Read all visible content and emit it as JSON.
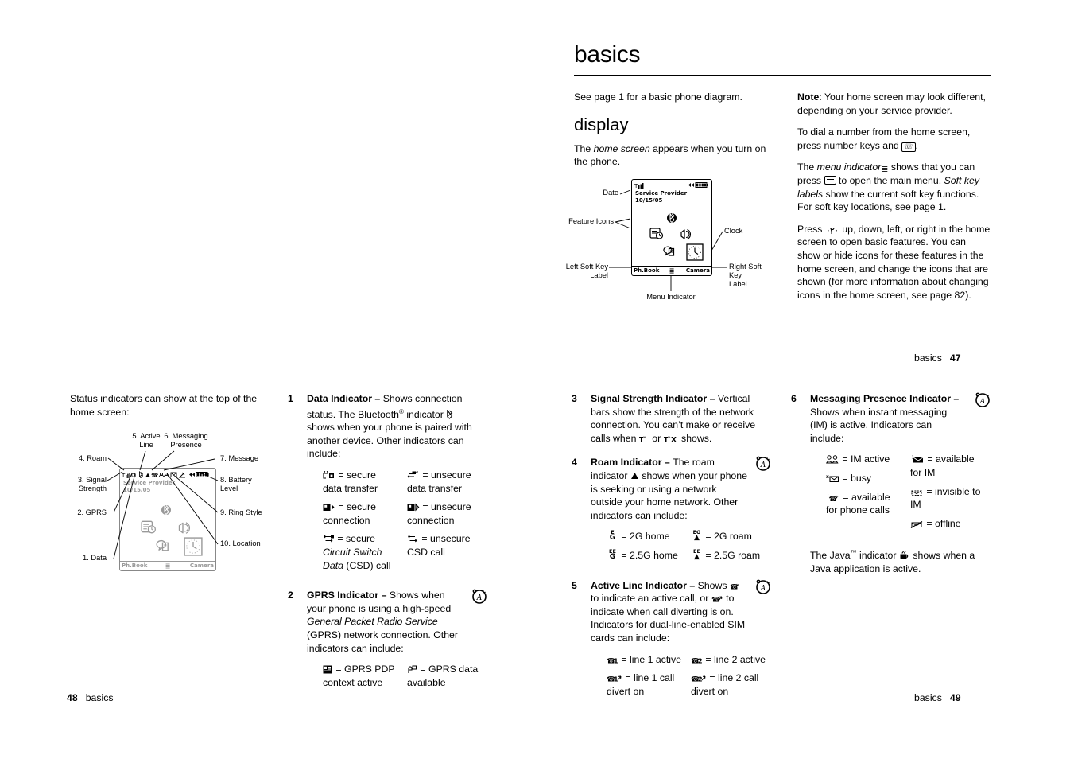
{
  "page47": {
    "title": "basics",
    "intro": "See page 1 for a basic phone diagram.",
    "section_heading": "display",
    "home_screen_p_a": "The ",
    "home_screen_p_it": "home screen",
    "home_screen_p_b": " appears when you turn on the phone.",
    "note_label": "Note",
    "note_text": ": Your home screen may look different, depending on your service provider.",
    "dial_text_a": "To dial a number from the home screen, press number keys and ",
    "dial_text_b": ".",
    "menu_a": "The ",
    "menu_it": "menu indicator",
    "menu_b": " shows that you can press ",
    "menu_c": " to open the main menu. ",
    "menu_it2": "Soft key labels",
    "menu_d": " show the current soft key functions. For soft key locations, see page 1.",
    "press_a": "Press ",
    "press_b": " up, down, left, or right in the home screen to open basic features. You can show or hide icons for these features in the home screen, and change the icons that are shown (for more information about changing icons in the home screen, see page 82).",
    "diagram": {
      "date_label": "Date",
      "feature_icons_label": "Feature Icons",
      "clock_label": "Clock",
      "left_soft_key_label": "Left Soft Key\nLabel",
      "right_soft_key_label": "Right Soft Key\nLabel",
      "menu_indicator_label": "Menu Indicator",
      "service_provider": "Service Provider",
      "date_value": "10/15/05",
      "left_soft_key": "Ph.Book",
      "right_soft_key": "Camera"
    }
  },
  "folios": {
    "p47_label": "basics",
    "p47_num": "47",
    "p48_label": "basics",
    "p48_num": "48",
    "p49_label": "basics",
    "p49_num": "49"
  },
  "col1": {
    "intro": "Status indicators can show at the top of the home screen:",
    "callouts": [
      {
        "id": "c4",
        "text": "4. Roam"
      },
      {
        "id": "c5",
        "text": "5. Active\nLine"
      },
      {
        "id": "c6",
        "text": "6. Messaging\nPresence"
      },
      {
        "id": "c7",
        "text": "7. Message"
      },
      {
        "id": "c3",
        "text": "3. Signal\nStrength"
      },
      {
        "id": "c8",
        "text": "8. Battery\nLevel"
      },
      {
        "id": "c2",
        "text": "2. GPRS"
      },
      {
        "id": "c9",
        "text": "9. Ring Style"
      },
      {
        "id": "c1",
        "text": "1. Data"
      },
      {
        "id": "c10",
        "text": "10. Location"
      }
    ],
    "screen": {
      "service_provider": "Service Provider",
      "date_value": "10/15/05",
      "left_soft_key": "Ph.Book",
      "right_soft_key": "Camera"
    }
  },
  "items": [
    {
      "number": "1",
      "title": "Data Indicator",
      "dash": " – ",
      "body_a": "Shows connection status. The Bluetooth",
      "body_sup": "®",
      "body_b": " indicator ",
      "body_c": " shows when your phone is paired with another device. Other indicators can include:",
      "marker": false,
      "keys": [
        {
          "icon": "secure-data-transfer-icon",
          "text": "= secure data transfer"
        },
        {
          "icon": "unsecure-data-transfer-icon",
          "text": "= unsecure data transfer"
        },
        {
          "icon": "secure-connection-icon",
          "text": "= secure connection"
        },
        {
          "icon": "unsecure-connection-icon",
          "text": "= unsecure connection"
        },
        {
          "icon": "secure-csd-call-icon",
          "text": "= secure "
        },
        {
          "icon": "unsecure-csd-call-icon",
          "text": "= unsecure CSD call"
        }
      ],
      "csd_italic": "Circuit Switch Data",
      "csd_tail": " (CSD) call"
    },
    {
      "number": "2",
      "title": "GPRS Indicator",
      "dash": " – ",
      "body_a": "Shows when your phone is using a high-speed ",
      "body_it": "General Packet Radio Service",
      "body_b": " (GPRS) network connection. Other indicators can include:",
      "marker": true,
      "keys": [
        {
          "icon": "gprs-pdp-context-icon",
          "text": "= GPRS PDP context active"
        },
        {
          "icon": "gprs-data-available-icon",
          "text": "= GPRS data available"
        }
      ]
    },
    {
      "number": "3",
      "title": "Signal Strength Indicator",
      "dash": " – ",
      "body_a": "Vertical bars show the strength of the network connection. You can’t make or receive calls when ",
      "body_b": " or ",
      "body_c": " shows.",
      "marker": false,
      "keys": []
    },
    {
      "number": "4",
      "title": "Roam Indicator",
      "dash": " – ",
      "body_a": "The roam indicator ",
      "body_b": " shows when your phone is seeking or using a network outside your home network. Other indicators can include:",
      "marker": true,
      "keys": [
        {
          "icon": "2g-home-icon",
          "text": "= 2G home"
        },
        {
          "icon": "2g-roam-icon",
          "text": "= 2G roam"
        },
        {
          "icon": "25g-home-icon",
          "text": "= 2.5G home"
        },
        {
          "icon": "25g-roam-icon",
          "text": "= 2.5G roam"
        }
      ]
    },
    {
      "number": "5",
      "title": "Active Line Indicator",
      "dash": " – ",
      "body_a": "Shows ",
      "body_b": " to indicate an active call, or ",
      "body_c": " to indicate when call diverting is on. Indicators for dual-line-enabled SIM cards can include:",
      "marker": true,
      "keys": [
        {
          "icon": "line-1-active-icon",
          "text": "= line 1 active"
        },
        {
          "icon": "line-2-active-icon",
          "text": "= line 2 active"
        },
        {
          "icon": "line-1-divert-icon",
          "text": "= line 1 call divert on"
        },
        {
          "icon": "line-2-divert-icon",
          "text": "= line 2 call divert on"
        }
      ]
    },
    {
      "number": "6",
      "title": "Messaging Presence Indicator",
      "dash": " –",
      "body_a": "Shows when instant messaging (IM) is active. Indicators can include:",
      "marker": true,
      "keys": [
        {
          "icon": "im-active-icon",
          "text": "= IM active"
        },
        {
          "icon": "available-for-im-icon",
          "text": "= available for IM"
        },
        {
          "icon": "busy-icon",
          "text": "= busy"
        },
        {
          "icon": "invisible-to-im-icon",
          "text": "= invisible to IM"
        },
        {
          "icon": "available-for-calls-icon",
          "text": "= available for phone calls"
        },
        {
          "icon": "offline-icon",
          "text": "= offline"
        }
      ],
      "java_a": "The Java",
      "java_tm": "™",
      "java_b": " indicator ",
      "java_c": " shows when a Java application is active."
    }
  ]
}
